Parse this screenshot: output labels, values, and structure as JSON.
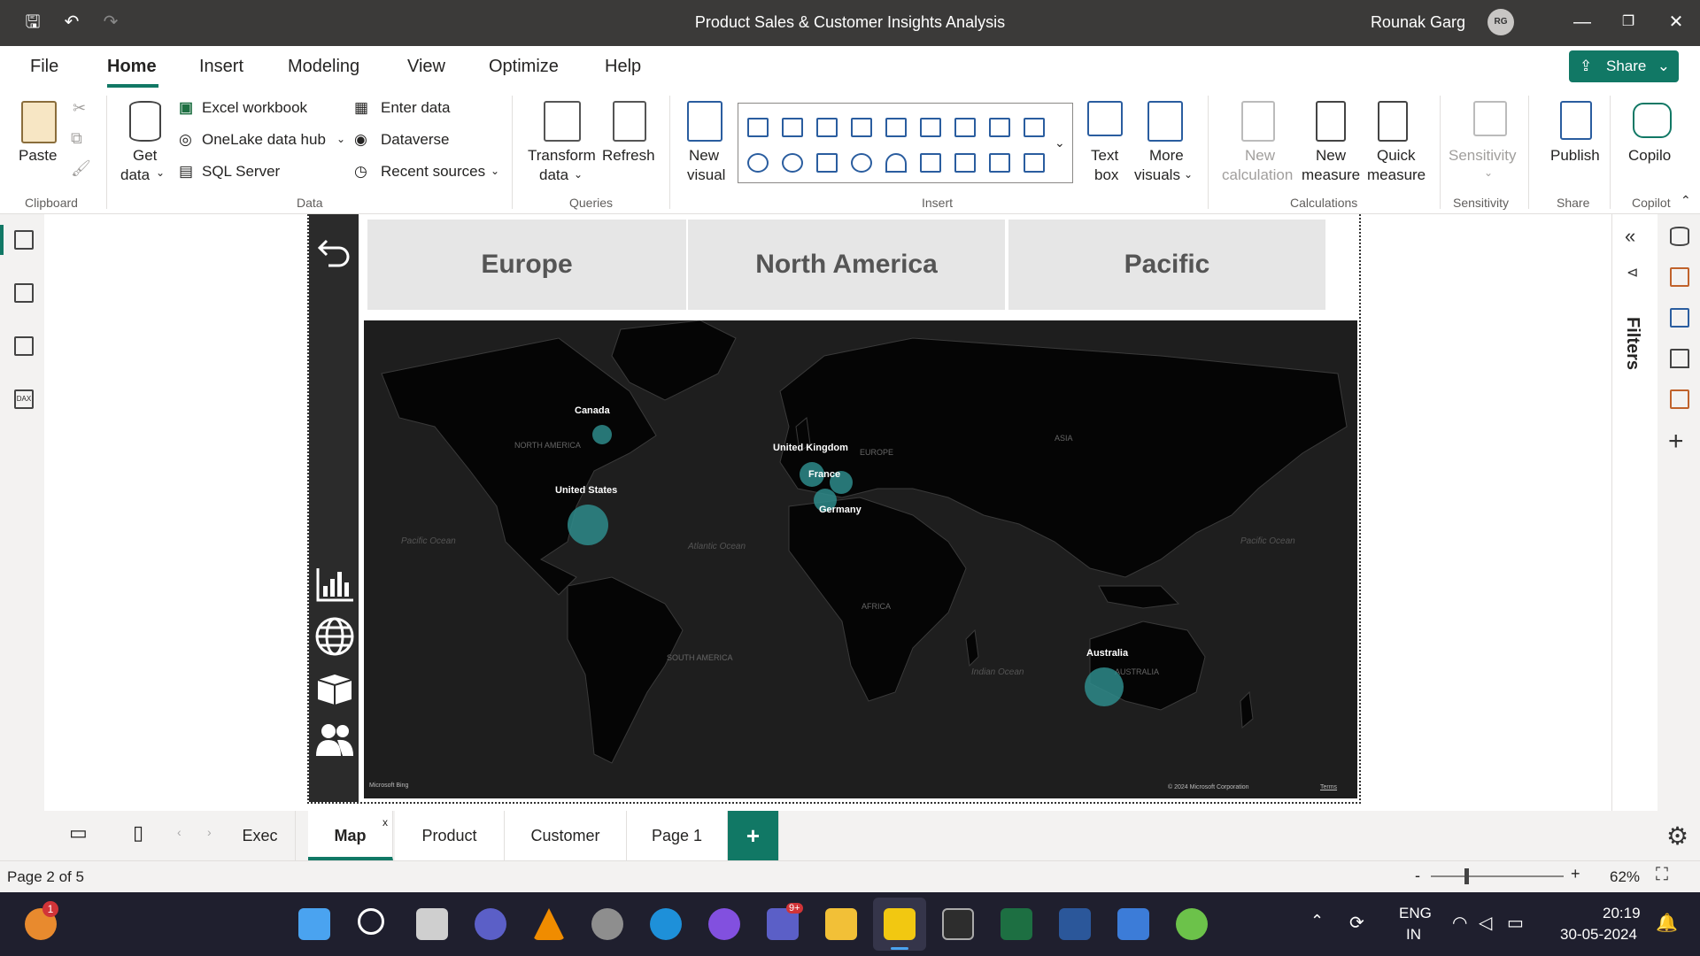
{
  "title_bar": {
    "title": "Product Sales & Customer Insights Analysis",
    "user_name": "Rounak Garg",
    "avatar_initials": "RG"
  },
  "menu_tabs": [
    "File",
    "Home",
    "Insert",
    "Modeling",
    "View",
    "Optimize",
    "Help"
  ],
  "share_label": "Share",
  "ribbon": {
    "clipboard": {
      "paste": "Paste",
      "group": "Clipboard"
    },
    "data": {
      "get_data_1": "Get",
      "get_data_2": "data",
      "excel": "Excel workbook",
      "onelake": "OneLake data hub",
      "sql": "SQL Server",
      "enter": "Enter data",
      "dataverse": "Dataverse",
      "recent": "Recent sources",
      "group": "Data"
    },
    "queries": {
      "transform_1": "Transform",
      "transform_2": "data",
      "refresh": "Refresh",
      "group": "Queries"
    },
    "insert": {
      "new_visual_1": "New",
      "new_visual_2": "visual",
      "text_box_1": "Text",
      "text_box_2": "box",
      "more_visuals_1": "More",
      "more_visuals_2": "visuals",
      "group": "Insert"
    },
    "calculations": {
      "new_calc_1": "New",
      "new_calc_2": "calculation",
      "new_measure_1": "New",
      "new_measure_2": "measure",
      "quick_measure_1": "Quick",
      "quick_measure_2": "measure",
      "group": "Calculations"
    },
    "sensitivity": {
      "label": "Sensitivity",
      "group": "Sensitivity"
    },
    "share": {
      "publish": "Publish",
      "group": "Share"
    },
    "copilot": {
      "label": "Copilo",
      "group": "Copilot"
    }
  },
  "regions": [
    "Europe",
    "North America",
    "Pacific"
  ],
  "map": {
    "labels": [
      {
        "name": "Canada"
      },
      {
        "name": "United States"
      },
      {
        "name": "United Kingdom"
      },
      {
        "name": "France"
      },
      {
        "name": "Germany"
      },
      {
        "name": "Australia"
      }
    ],
    "continent_labels": [
      "NORTH AMERICA",
      "EUROPE",
      "ASIA",
      "AFRICA",
      "SOUTH AMERICA",
      "AUSTRALIA"
    ],
    "ocean_labels": [
      "Pacific Ocean",
      "Atlantic Ocean",
      "Indian Ocean",
      "Pacific Ocean"
    ],
    "attribution_left": "Microsoft Bing",
    "attribution_right": "© 2024 Microsoft Corporation",
    "terms": "Terms"
  },
  "filters_label": "Filters",
  "page_tabs": [
    "Exec",
    "Map",
    "Product",
    "Customer",
    "Page 1"
  ],
  "active_page_tab": "Map",
  "status": {
    "page_info": "Page 2 of 5",
    "zoom": "62%"
  },
  "taskbar": {
    "lang_1": "ENG",
    "lang_2": "IN",
    "time": "20:19",
    "date": "30-05-2024",
    "notif_badge": "1",
    "teams_badge": "9+"
  },
  "colors": {
    "accent": "#117865",
    "bubble": "#2e8b8b",
    "map_bg": "#1e1e1e"
  }
}
